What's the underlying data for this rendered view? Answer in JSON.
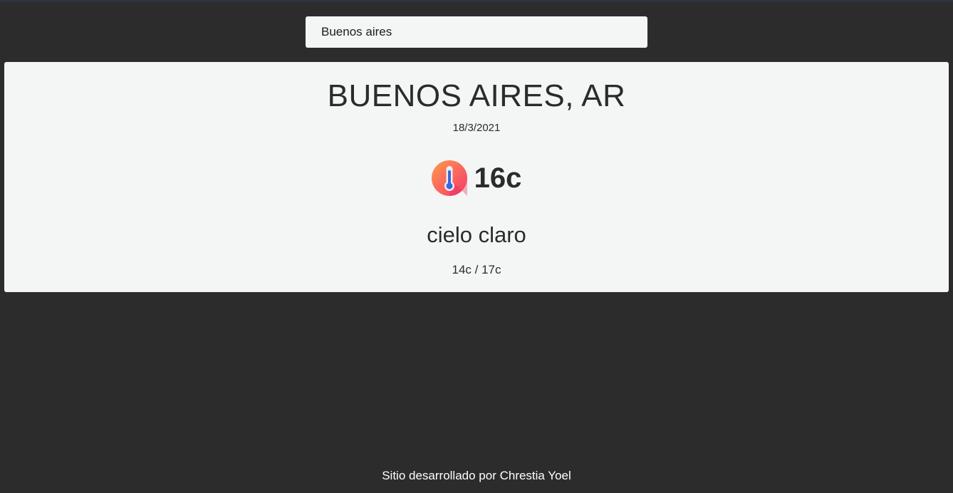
{
  "search": {
    "value": "Buenos aires",
    "placeholder": ""
  },
  "weather": {
    "city": "BUENOS AIRES, AR",
    "date": "18/3/2021",
    "icon": "thermometer-icon",
    "temperature": "16c",
    "description": "cielo claro",
    "range": "14c / 17c"
  },
  "footer": {
    "text": "Sitio desarrollado por Chrestia Yoel"
  },
  "colors": {
    "background": "#2c2c2c",
    "card": "#f4f6f6",
    "text": "#2b2b2b",
    "footer_text": "#ffffff"
  }
}
